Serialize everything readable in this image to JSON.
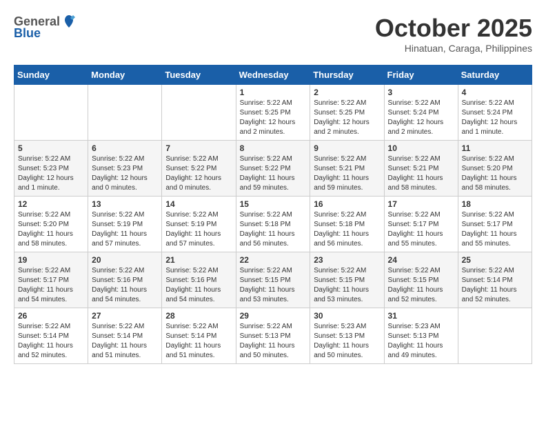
{
  "header": {
    "logo_general": "General",
    "logo_blue": "Blue",
    "month": "October 2025",
    "location": "Hinatuan, Caraga, Philippines"
  },
  "weekdays": [
    "Sunday",
    "Monday",
    "Tuesday",
    "Wednesday",
    "Thursday",
    "Friday",
    "Saturday"
  ],
  "weeks": [
    [
      {
        "day": "",
        "sunrise": "",
        "sunset": "",
        "daylight": ""
      },
      {
        "day": "",
        "sunrise": "",
        "sunset": "",
        "daylight": ""
      },
      {
        "day": "",
        "sunrise": "",
        "sunset": "",
        "daylight": ""
      },
      {
        "day": "1",
        "sunrise": "Sunrise: 5:22 AM",
        "sunset": "Sunset: 5:25 PM",
        "daylight": "Daylight: 12 hours and 2 minutes."
      },
      {
        "day": "2",
        "sunrise": "Sunrise: 5:22 AM",
        "sunset": "Sunset: 5:25 PM",
        "daylight": "Daylight: 12 hours and 2 minutes."
      },
      {
        "day": "3",
        "sunrise": "Sunrise: 5:22 AM",
        "sunset": "Sunset: 5:24 PM",
        "daylight": "Daylight: 12 hours and 2 minutes."
      },
      {
        "day": "4",
        "sunrise": "Sunrise: 5:22 AM",
        "sunset": "Sunset: 5:24 PM",
        "daylight": "Daylight: 12 hours and 1 minute."
      }
    ],
    [
      {
        "day": "5",
        "sunrise": "Sunrise: 5:22 AM",
        "sunset": "Sunset: 5:23 PM",
        "daylight": "Daylight: 12 hours and 1 minute."
      },
      {
        "day": "6",
        "sunrise": "Sunrise: 5:22 AM",
        "sunset": "Sunset: 5:23 PM",
        "daylight": "Daylight: 12 hours and 0 minutes."
      },
      {
        "day": "7",
        "sunrise": "Sunrise: 5:22 AM",
        "sunset": "Sunset: 5:22 PM",
        "daylight": "Daylight: 12 hours and 0 minutes."
      },
      {
        "day": "8",
        "sunrise": "Sunrise: 5:22 AM",
        "sunset": "Sunset: 5:22 PM",
        "daylight": "Daylight: 11 hours and 59 minutes."
      },
      {
        "day": "9",
        "sunrise": "Sunrise: 5:22 AM",
        "sunset": "Sunset: 5:21 PM",
        "daylight": "Daylight: 11 hours and 59 minutes."
      },
      {
        "day": "10",
        "sunrise": "Sunrise: 5:22 AM",
        "sunset": "Sunset: 5:21 PM",
        "daylight": "Daylight: 11 hours and 58 minutes."
      },
      {
        "day": "11",
        "sunrise": "Sunrise: 5:22 AM",
        "sunset": "Sunset: 5:20 PM",
        "daylight": "Daylight: 11 hours and 58 minutes."
      }
    ],
    [
      {
        "day": "12",
        "sunrise": "Sunrise: 5:22 AM",
        "sunset": "Sunset: 5:20 PM",
        "daylight": "Daylight: 11 hours and 58 minutes."
      },
      {
        "day": "13",
        "sunrise": "Sunrise: 5:22 AM",
        "sunset": "Sunset: 5:19 PM",
        "daylight": "Daylight: 11 hours and 57 minutes."
      },
      {
        "day": "14",
        "sunrise": "Sunrise: 5:22 AM",
        "sunset": "Sunset: 5:19 PM",
        "daylight": "Daylight: 11 hours and 57 minutes."
      },
      {
        "day": "15",
        "sunrise": "Sunrise: 5:22 AM",
        "sunset": "Sunset: 5:18 PM",
        "daylight": "Daylight: 11 hours and 56 minutes."
      },
      {
        "day": "16",
        "sunrise": "Sunrise: 5:22 AM",
        "sunset": "Sunset: 5:18 PM",
        "daylight": "Daylight: 11 hours and 56 minutes."
      },
      {
        "day": "17",
        "sunrise": "Sunrise: 5:22 AM",
        "sunset": "Sunset: 5:17 PM",
        "daylight": "Daylight: 11 hours and 55 minutes."
      },
      {
        "day": "18",
        "sunrise": "Sunrise: 5:22 AM",
        "sunset": "Sunset: 5:17 PM",
        "daylight": "Daylight: 11 hours and 55 minutes."
      }
    ],
    [
      {
        "day": "19",
        "sunrise": "Sunrise: 5:22 AM",
        "sunset": "Sunset: 5:17 PM",
        "daylight": "Daylight: 11 hours and 54 minutes."
      },
      {
        "day": "20",
        "sunrise": "Sunrise: 5:22 AM",
        "sunset": "Sunset: 5:16 PM",
        "daylight": "Daylight: 11 hours and 54 minutes."
      },
      {
        "day": "21",
        "sunrise": "Sunrise: 5:22 AM",
        "sunset": "Sunset: 5:16 PM",
        "daylight": "Daylight: 11 hours and 54 minutes."
      },
      {
        "day": "22",
        "sunrise": "Sunrise: 5:22 AM",
        "sunset": "Sunset: 5:15 PM",
        "daylight": "Daylight: 11 hours and 53 minutes."
      },
      {
        "day": "23",
        "sunrise": "Sunrise: 5:22 AM",
        "sunset": "Sunset: 5:15 PM",
        "daylight": "Daylight: 11 hours and 53 minutes."
      },
      {
        "day": "24",
        "sunrise": "Sunrise: 5:22 AM",
        "sunset": "Sunset: 5:15 PM",
        "daylight": "Daylight: 11 hours and 52 minutes."
      },
      {
        "day": "25",
        "sunrise": "Sunrise: 5:22 AM",
        "sunset": "Sunset: 5:14 PM",
        "daylight": "Daylight: 11 hours and 52 minutes."
      }
    ],
    [
      {
        "day": "26",
        "sunrise": "Sunrise: 5:22 AM",
        "sunset": "Sunset: 5:14 PM",
        "daylight": "Daylight: 11 hours and 52 minutes."
      },
      {
        "day": "27",
        "sunrise": "Sunrise: 5:22 AM",
        "sunset": "Sunset: 5:14 PM",
        "daylight": "Daylight: 11 hours and 51 minutes."
      },
      {
        "day": "28",
        "sunrise": "Sunrise: 5:22 AM",
        "sunset": "Sunset: 5:14 PM",
        "daylight": "Daylight: 11 hours and 51 minutes."
      },
      {
        "day": "29",
        "sunrise": "Sunrise: 5:22 AM",
        "sunset": "Sunset: 5:13 PM",
        "daylight": "Daylight: 11 hours and 50 minutes."
      },
      {
        "day": "30",
        "sunrise": "Sunrise: 5:23 AM",
        "sunset": "Sunset: 5:13 PM",
        "daylight": "Daylight: 11 hours and 50 minutes."
      },
      {
        "day": "31",
        "sunrise": "Sunrise: 5:23 AM",
        "sunset": "Sunset: 5:13 PM",
        "daylight": "Daylight: 11 hours and 49 minutes."
      },
      {
        "day": "",
        "sunrise": "",
        "sunset": "",
        "daylight": ""
      }
    ]
  ]
}
